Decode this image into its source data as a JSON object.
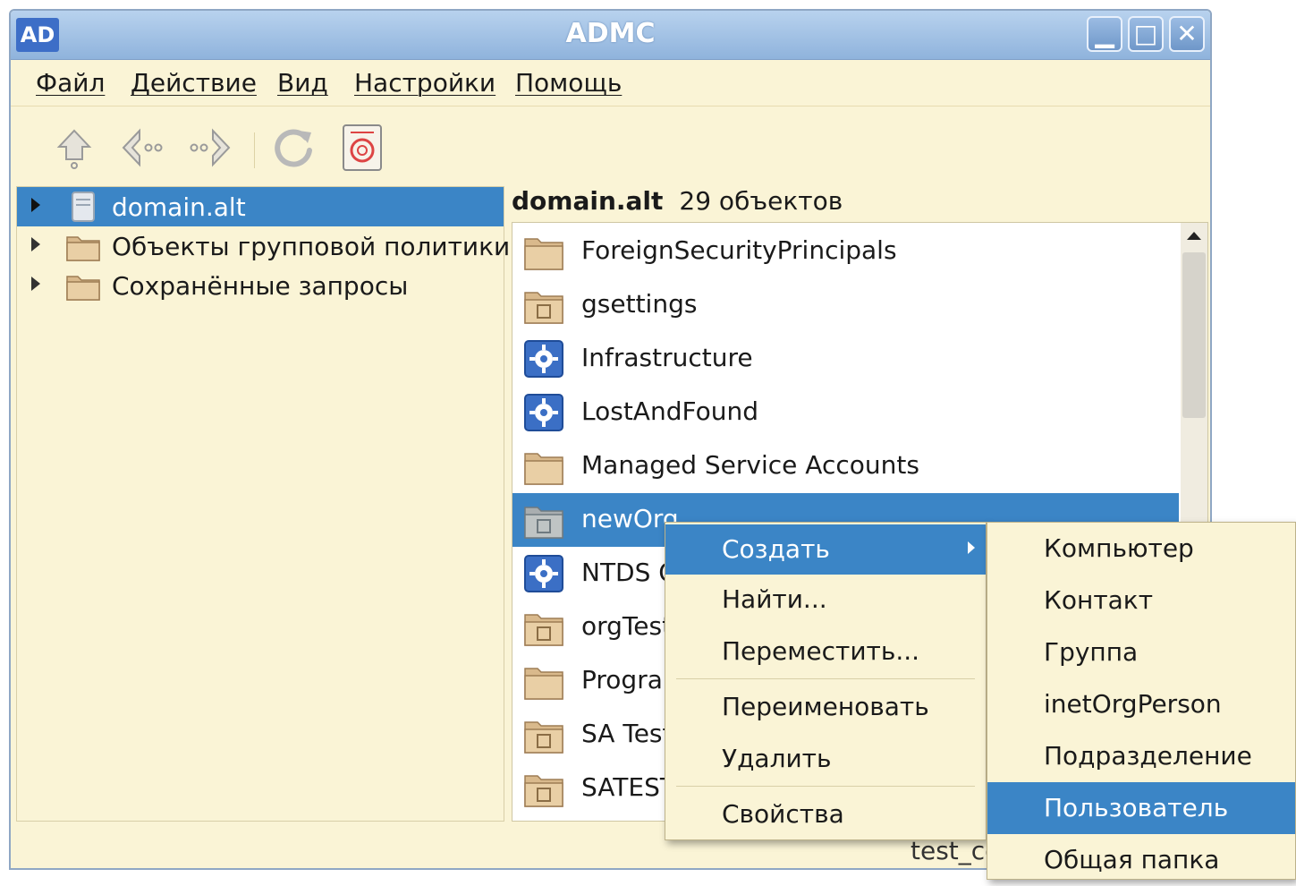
{
  "window": {
    "title": "ADMC",
    "app_icon": "AD",
    "buttons": {
      "minimize": "▁",
      "maximize": "□",
      "close": "✕"
    }
  },
  "menubar": [
    "Файл",
    "Действие",
    "Вид",
    "Настройки",
    "Помощь"
  ],
  "toolbar": [
    "up-icon",
    "back-icon",
    "forward-icon",
    "refresh-icon",
    "manual-icon"
  ],
  "tree": [
    {
      "label": "domain.alt",
      "icon": "server-icon",
      "selected": true
    },
    {
      "label": "Объекты групповой политики",
      "icon": "folder-icon"
    },
    {
      "label": "Сохранённые запросы",
      "icon": "folder-icon"
    }
  ],
  "content": {
    "header_name": "domain.alt",
    "header_count": "29 объектов",
    "items": [
      {
        "label": "ForeignSecurityPrincipals",
        "icon": "folder-icon"
      },
      {
        "label": "gsettings",
        "icon": "ou-folder-icon"
      },
      {
        "label": "Infrastructure",
        "icon": "gear-icon"
      },
      {
        "label": "LostAndFound",
        "icon": "gear-icon"
      },
      {
        "label": "Managed Service Accounts",
        "icon": "folder-icon"
      },
      {
        "label": "newOrg",
        "icon": "ou-folder-icon",
        "selected": true
      },
      {
        "label": "NTDS Q",
        "icon": "gear-icon"
      },
      {
        "label": "orgTest",
        "icon": "ou-folder-icon"
      },
      {
        "label": "Program",
        "icon": "folder-icon"
      },
      {
        "label": "SA Test",
        "icon": "ou-folder-icon"
      },
      {
        "label": "SATEST",
        "icon": "ou-folder-icon"
      }
    ]
  },
  "status": {
    "text": "test_co"
  },
  "context_menu": [
    "Создать",
    "Найти...",
    "Переместить...",
    "Переименовать",
    "Удалить",
    "Свойства"
  ],
  "submenu": [
    "Компьютер",
    "Контакт",
    "Группа",
    "inetOrgPerson",
    "Подразделение",
    "Пользователь",
    "Общая папка"
  ],
  "colors": {
    "selection": "#3b85c6",
    "window_bg": "#faf4d6",
    "titlebar": "#8fb3dc"
  }
}
